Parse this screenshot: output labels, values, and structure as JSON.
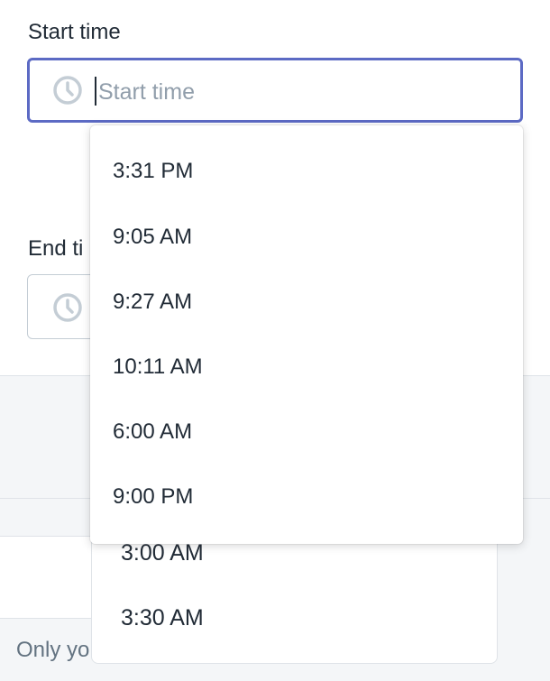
{
  "start_field": {
    "label": "Start time",
    "placeholder": "Start time",
    "icon": "clock-icon"
  },
  "end_field": {
    "label": "End ti",
    "icon": "clock-icon"
  },
  "dropdown": {
    "options": [
      "3:31 PM",
      "9:05 AM",
      "9:27 AM",
      "10:11 AM",
      "6:00 AM",
      "9:00 PM"
    ]
  },
  "under_list": {
    "items": [
      "3:00 AM",
      "3:30 AM"
    ]
  },
  "footer": {
    "text": "Only yo"
  },
  "colors": {
    "focus_border": "#5c6ac4",
    "placeholder": "#919eab",
    "background_gray": "#f4f6f8"
  }
}
